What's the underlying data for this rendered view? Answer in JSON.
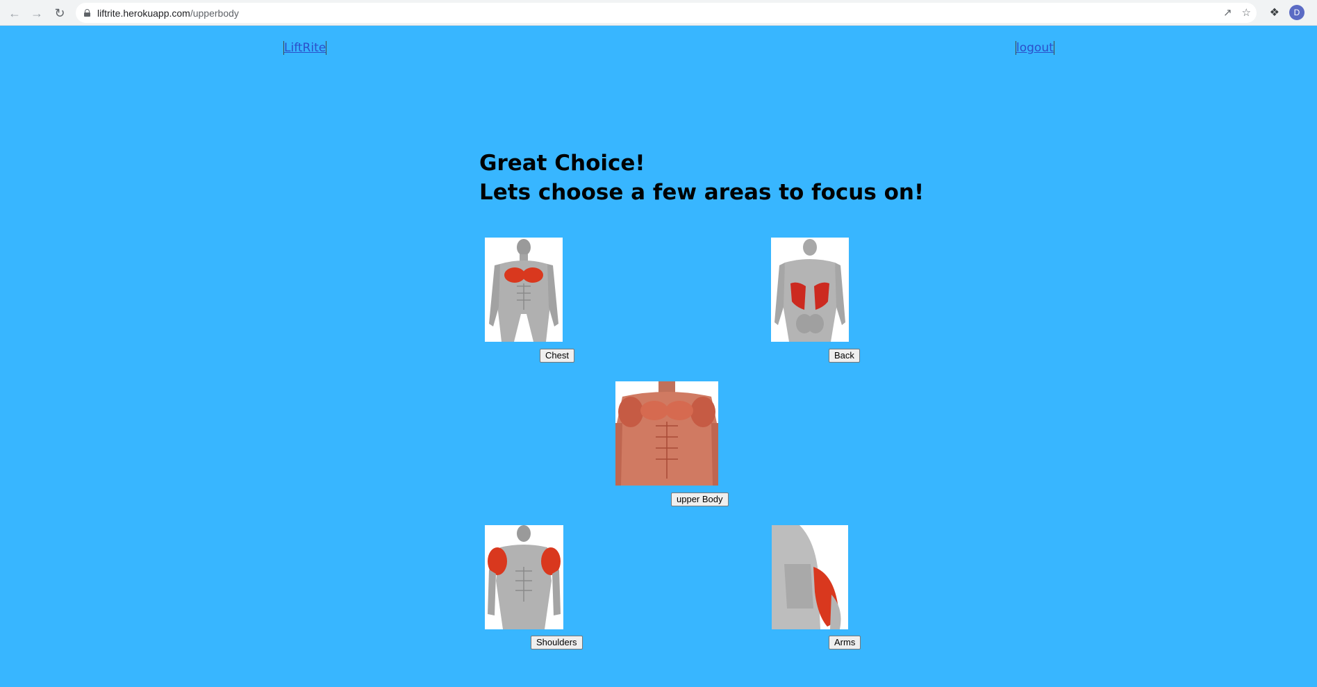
{
  "browser": {
    "url_host": "liftrite.herokuapp.com",
    "url_path": "/upperbody",
    "profile_initial": "D"
  },
  "nav": {
    "brand": "LiftRite",
    "logout": "logout"
  },
  "headings": {
    "line1": "Great Choice!",
    "line2": "Lets choose a few areas to focus on!"
  },
  "options": {
    "chest": "Chest",
    "back": "Back",
    "upper_body": "upper Body",
    "shoulders": "Shoulders",
    "arms": "Arms"
  },
  "colors": {
    "page_background": "#38b6ff",
    "link": "#2c4fc9",
    "muscle_highlight": "#d9381e"
  }
}
